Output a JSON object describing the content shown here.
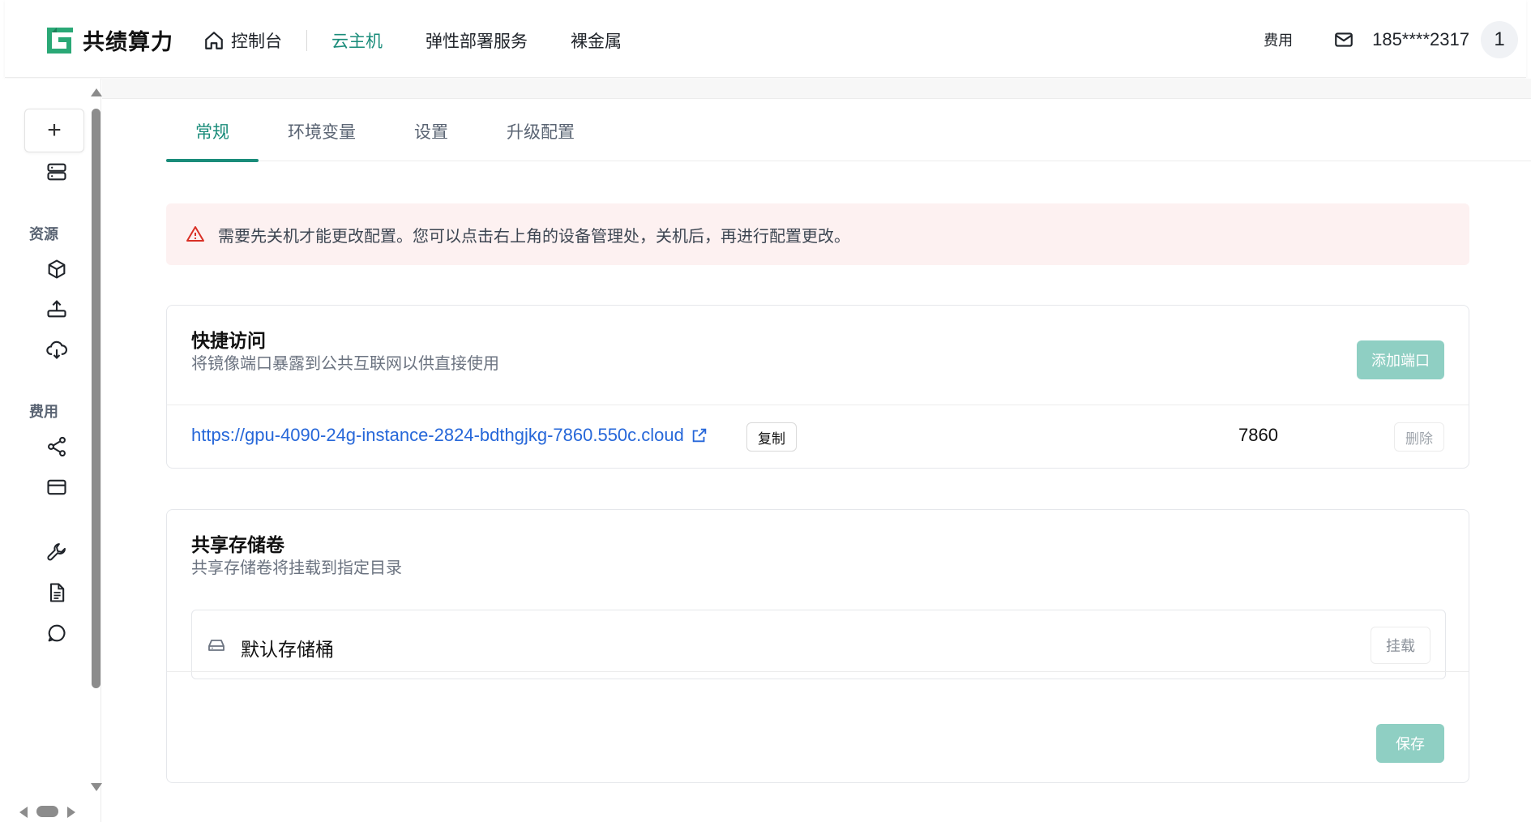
{
  "brand": {
    "name": "共绩算力",
    "accent": "#1a8c7a",
    "logo_color": "#2aa876"
  },
  "nav": {
    "home_label": "控制台",
    "items": [
      {
        "label": "云主机",
        "active": true
      },
      {
        "label": "弹性部署服务",
        "active": false
      },
      {
        "label": "裸金属",
        "active": false
      }
    ]
  },
  "top_right": {
    "fee_label": "费用",
    "phone": "185****2317",
    "avatar_text": "1"
  },
  "sidebar": {
    "add_symbol": "+",
    "sections": [
      {
        "label": "资源"
      },
      {
        "label": "费用"
      }
    ],
    "icons": [
      "server-icon",
      "cube-icon",
      "upload-icon",
      "cloud-icon",
      "share-icon",
      "card-icon",
      "wrench-icon",
      "document-icon",
      "chat-icon"
    ]
  },
  "tabs": [
    {
      "label": "常规",
      "active": true
    },
    {
      "label": "环境变量",
      "active": false
    },
    {
      "label": "设置",
      "active": false
    },
    {
      "label": "升级配置",
      "active": false
    }
  ],
  "alert": {
    "text": "需要先关机才能更改配置。您可以点击右上角的设备管理处，关机后，再进行配置更改。",
    "color": "#fdf1f1"
  },
  "quick_access": {
    "title": "快捷访问",
    "subtitle": "将镜像端口暴露到公共互联网以供直接使用",
    "add_button": "添加端口",
    "ports": [
      {
        "url": "https://gpu-4090-24g-instance-2824-bdthgjkg-7860.550c.cloud",
        "copy_label": "复制",
        "port": "7860",
        "delete_label": "删除"
      }
    ]
  },
  "shared_storage": {
    "title": "共享存储卷",
    "subtitle": "共享存储卷将挂载到指定目录",
    "volumes": [
      {
        "name": "默认存储桶",
        "mount_label": "挂载"
      }
    ],
    "save_button": "保存"
  }
}
